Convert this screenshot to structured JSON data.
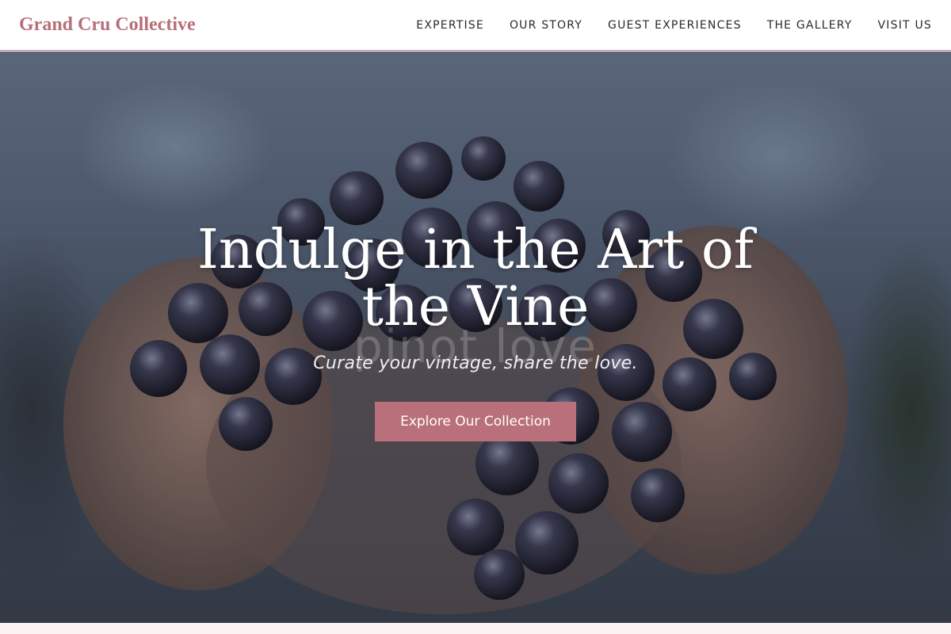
{
  "header": {
    "brand": "Grand Cru Collective",
    "nav": [
      {
        "label": "EXPERTISE"
      },
      {
        "label": "OUR STORY"
      },
      {
        "label": "GUEST EXPERIENCES"
      },
      {
        "label": "THE GALLERY"
      },
      {
        "label": "VISIT US"
      }
    ]
  },
  "hero": {
    "title": "Indulge in the Art of the Vine",
    "ghost_text": "pinot love",
    "subtitle": "Curate your vintage, share the love.",
    "cta_label": "Explore Our Collection"
  },
  "colors": {
    "accent": "#b9707a",
    "brand": "#b86f78",
    "nav_text": "#2a2a2a",
    "hero_text": "#ffffff"
  }
}
